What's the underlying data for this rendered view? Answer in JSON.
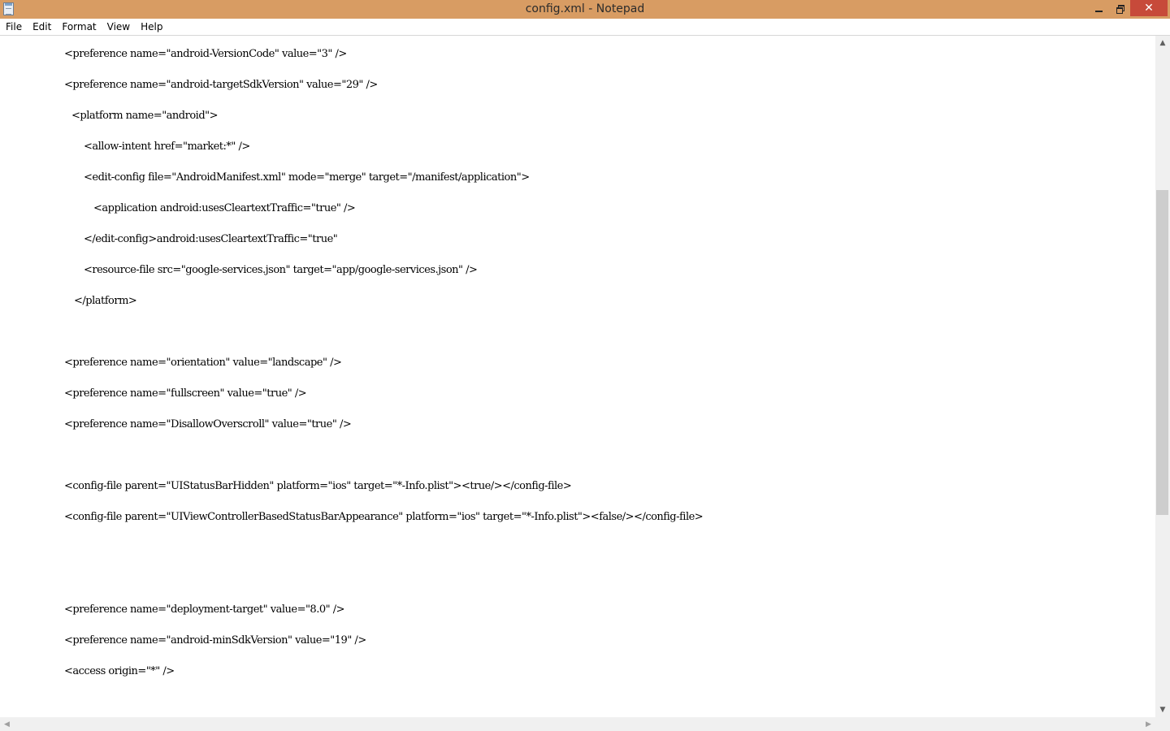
{
  "window": {
    "title": "config.xml - Notepad",
    "close_glyph": "✕",
    "icons": [
      "notepad-app-icon",
      "minimize-icon",
      "restore-icon",
      "close-icon"
    ]
  },
  "menu": {
    "items": [
      "File",
      "Edit",
      "Format",
      "View",
      "Help"
    ]
  },
  "editor": {
    "lines": [
      "<preference name=\"android-VersionCode\" value=\"3\" />",
      "<preference name=\"android-targetSdkVersion\" value=\"29\" />",
      "<platform name=\"android\">",
      "<allow-intent href=\"market:*\" />",
      "<edit-config file=\"AndroidManifest.xml\" mode=\"merge\" target=\"/manifest/application\">",
      "<application android:usesCleartextTraffic=\"true\" />",
      "</edit-config>android:usesCleartextTraffic=\"true\"",
      "<resource-file src=\"google-services.json\" target=\"app/google-services.json\" />",
      "</platform>",
      "<preference name=\"orientation\" value=\"landscape\" />",
      "<preference name=\"fullscreen\" value=\"true\" />",
      "<preference name=\"DisallowOverscroll\" value=\"true\" />",
      "<config-file parent=\"UIStatusBarHidden\" platform=\"ios\" target=\"*-Info.plist\"><true/></config-file>",
      "<config-file parent=\"UIViewControllerBasedStatusBarAppearance\" platform=\"ios\" target=\"*-Info.plist\"><false/></config-file>",
      "<preference name=\"deployment-target\" value=\"8.0\" />",
      "<preference name=\"android-minSdkVersion\" value=\"19\" />",
      "<access origin=\"*\" />"
    ]
  },
  "scrollbars": {
    "up_glyph": "▲",
    "down_glyph": "▼",
    "left_glyph": "◀",
    "right_glyph": "▶"
  }
}
